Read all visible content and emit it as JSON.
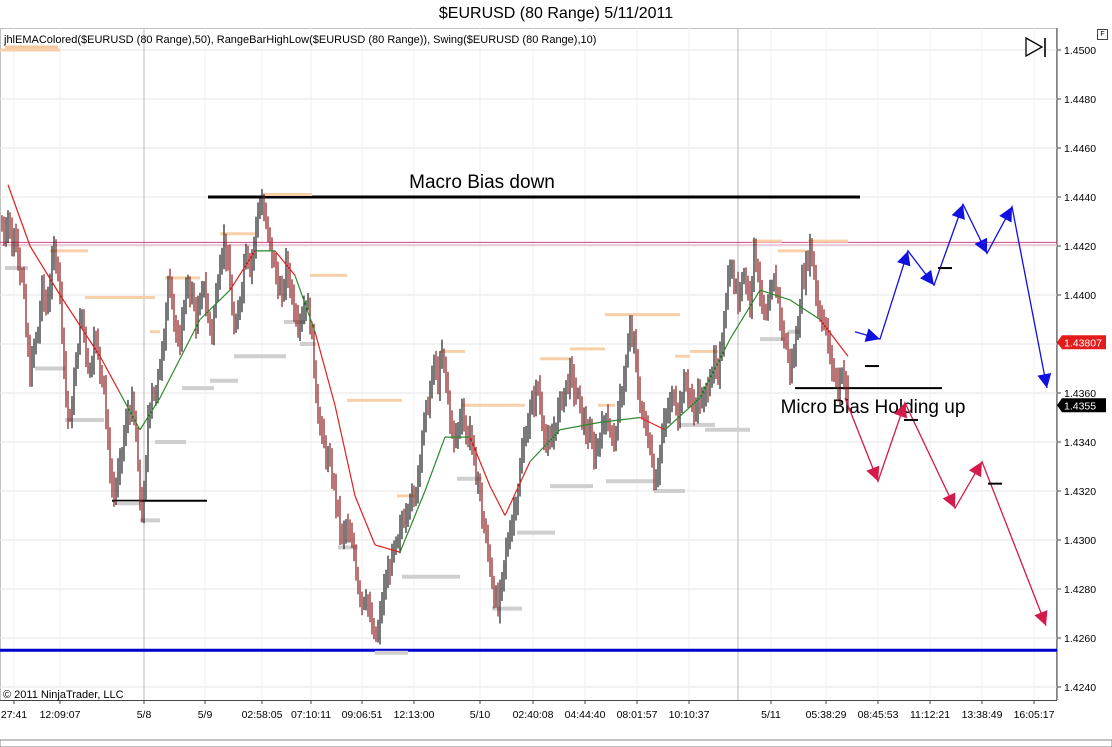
{
  "chart_data": {
    "type": "bar",
    "title": "$EURUSD (80 Range)  5/11/2011",
    "indicators": "jhlEMAColored($EURUSD (80 Range),50), RangeBarHighLow($EURUSD (80 Range)), Swing($EURUSD (80 Range),10)",
    "copyright": "© 2011 NinjaTrader, LLC",
    "ylim": [
      1.4237,
      1.4512
    ],
    "y_ticks": [
      "1.4500",
      "1.4480",
      "1.4460",
      "1.4440",
      "1.4420",
      "1.4400",
      "1.4380",
      "1.4360",
      "1.4340",
      "1.4320",
      "1.4300",
      "1.4280",
      "1.4260",
      "1.4240"
    ],
    "x_ticks": [
      "27:41",
      "12:09:07",
      "5/8",
      "5/9",
      "02:58:05",
      "07:10:11",
      "09:06:51",
      "12:13:00",
      "5/10",
      "02:40:08",
      "04:44:40",
      "08:01:57",
      "10:10:37",
      "5/11",
      "05:38:29",
      "08:45:53",
      "11:12:21",
      "13:38:49",
      "16:05:17"
    ],
    "price_labels": [
      {
        "text": "1.43807",
        "value": 1.43807,
        "color": "#e31b1b"
      },
      {
        "text": "1.4355",
        "value": 1.4355,
        "color": "#000000"
      }
    ],
    "levels": [
      {
        "name": "Macro Bias down",
        "value": 1.444
      },
      {
        "name": "Micro Bias Holding up",
        "value": 1.4362
      },
      {
        "name": "support",
        "value": 1.4255,
        "color": "#0000cc"
      },
      {
        "name": "resistance",
        "value": 1.44215,
        "color": "#cc4488"
      }
    ],
    "annotations": [
      "Macro Bias down",
      "Micro Bias Holding up"
    ],
    "price_path": [
      [
        0,
        1.4437
      ],
      [
        3,
        1.4424
      ],
      [
        8,
        1.4432
      ],
      [
        12,
        1.442
      ],
      [
        16,
        1.4426
      ],
      [
        20,
        1.441
      ],
      [
        23,
        1.4405
      ],
      [
        26,
        1.4385
      ],
      [
        30,
        1.4368
      ],
      [
        34,
        1.4378
      ],
      [
        38,
        1.4385
      ],
      [
        42,
        1.4402
      ],
      [
        46,
        1.4395
      ],
      [
        50,
        1.4405
      ],
      [
        54,
        1.4418
      ],
      [
        58,
        1.4412
      ],
      [
        61,
        1.4395
      ],
      [
        64,
        1.4372
      ],
      [
        67,
        1.4352
      ],
      [
        70,
        1.4348
      ],
      [
        73,
        1.436
      ],
      [
        76,
        1.4372
      ],
      [
        79,
        1.4385
      ],
      [
        82,
        1.4392
      ],
      [
        85,
        1.438
      ],
      [
        88,
        1.4372
      ],
      [
        91,
        1.4368
      ],
      [
        94,
        1.4385
      ],
      [
        97,
        1.4378
      ],
      [
        100,
        1.437
      ],
      [
        104,
        1.4365
      ],
      [
        107,
        1.4342
      ],
      [
        110,
        1.433
      ],
      [
        113,
        1.4318
      ],
      [
        116,
        1.4322
      ],
      [
        120,
        1.433
      ],
      [
        124,
        1.4342
      ],
      [
        128,
        1.4352
      ],
      [
        132,
        1.4355
      ],
      [
        136,
        1.4342
      ],
      [
        139,
        1.432
      ],
      [
        142,
        1.4312
      ],
      [
        145,
        1.432
      ],
      [
        148,
        1.435
      ],
      [
        152,
        1.4362
      ],
      [
        156,
        1.4358
      ],
      [
        160,
        1.4372
      ],
      [
        164,
        1.4385
      ],
      [
        168,
        1.4405
      ],
      [
        172,
        1.4395
      ],
      [
        176,
        1.4385
      ],
      [
        180,
        1.4382
      ],
      [
        184,
        1.4395
      ],
      [
        188,
        1.4405
      ],
      [
        192,
        1.44
      ],
      [
        196,
        1.439
      ],
      [
        200,
        1.4395
      ],
      [
        204,
        1.4405
      ],
      [
        208,
        1.439
      ],
      [
        212,
        1.4385
      ],
      [
        216,
        1.44
      ],
      [
        220,
        1.4415
      ],
      [
        224,
        1.4422
      ],
      [
        228,
        1.4412
      ],
      [
        232,
        1.4395
      ],
      [
        235,
        1.4382
      ],
      [
        238,
        1.4392
      ],
      [
        242,
        1.4405
      ],
      [
        246,
        1.442
      ],
      [
        250,
        1.4412
      ],
      [
        254,
        1.442
      ],
      [
        258,
        1.4435
      ],
      [
        262,
        1.4438
      ],
      [
        266,
        1.4428
      ],
      [
        270,
        1.442
      ],
      [
        274,
        1.4412
      ],
      [
        278,
        1.4405
      ],
      [
        282,
        1.4398
      ],
      [
        286,
        1.4412
      ],
      [
        290,
        1.4405
      ],
      [
        294,
        1.4395
      ],
      [
        298,
        1.439
      ],
      [
        302,
        1.4392
      ],
      [
        306,
        1.4398
      ],
      [
        310,
        1.439
      ],
      [
        314,
        1.4372
      ],
      [
        318,
        1.4352
      ],
      [
        322,
        1.4342
      ],
      [
        326,
        1.4335
      ],
      [
        330,
        1.433
      ],
      [
        334,
        1.4322
      ],
      [
        338,
        1.431
      ],
      [
        342,
        1.43
      ],
      [
        346,
        1.4305
      ],
      [
        350,
        1.43
      ],
      [
        354,
        1.4295
      ],
      [
        358,
        1.4282
      ],
      [
        362,
        1.4275
      ],
      [
        366,
        1.4278
      ],
      [
        370,
        1.4268
      ],
      [
        374,
        1.426
      ],
      [
        378,
        1.4262
      ],
      [
        382,
        1.4275
      ],
      [
        386,
        1.4283
      ],
      [
        390,
        1.429
      ],
      [
        394,
        1.4295
      ],
      [
        398,
        1.4298
      ],
      [
        402,
        1.4308
      ],
      [
        406,
        1.4312
      ],
      [
        410,
        1.4318
      ],
      [
        414,
        1.4315
      ],
      [
        418,
        1.4328
      ],
      [
        422,
        1.4342
      ],
      [
        426,
        1.4352
      ],
      [
        430,
        1.436
      ],
      [
        434,
        1.4372
      ],
      [
        438,
        1.4365
      ],
      [
        442,
        1.4375
      ],
      [
        446,
        1.4365
      ],
      [
        450,
        1.435
      ],
      [
        454,
        1.434
      ],
      [
        458,
        1.4345
      ],
      [
        462,
        1.4355
      ],
      [
        466,
        1.4342
      ],
      [
        470,
        1.4345
      ],
      [
        474,
        1.433
      ],
      [
        478,
        1.4325
      ],
      [
        482,
        1.431
      ],
      [
        486,
        1.43
      ],
      [
        490,
        1.429
      ],
      [
        494,
        1.4278
      ],
      [
        498,
        1.4272
      ],
      [
        502,
        1.4282
      ],
      [
        506,
        1.4295
      ],
      [
        510,
        1.4305
      ],
      [
        514,
        1.4312
      ],
      [
        518,
        1.4322
      ],
      [
        522,
        1.4335
      ],
      [
        526,
        1.4345
      ],
      [
        530,
        1.4352
      ],
      [
        534,
        1.4358
      ],
      [
        538,
        1.4362
      ],
      [
        542,
        1.435
      ],
      [
        546,
        1.434
      ],
      [
        550,
        1.4338
      ],
      [
        554,
        1.4345
      ],
      [
        558,
        1.4352
      ],
      [
        562,
        1.4358
      ],
      [
        566,
        1.4362
      ],
      [
        570,
        1.4368
      ],
      [
        574,
        1.4362
      ],
      [
        578,
        1.4358
      ],
      [
        582,
        1.435
      ],
      [
        586,
        1.4345
      ],
      [
        590,
        1.4342
      ],
      [
        594,
        1.4335
      ],
      [
        598,
        1.434
      ],
      [
        602,
        1.4345
      ],
      [
        606,
        1.4352
      ],
      [
        610,
        1.4345
      ],
      [
        614,
        1.434
      ],
      [
        618,
        1.435
      ],
      [
        622,
        1.4362
      ],
      [
        626,
        1.4372
      ],
      [
        630,
        1.4385
      ],
      [
        634,
        1.438
      ],
      [
        638,
        1.4362
      ],
      [
        642,
        1.4352
      ],
      [
        646,
        1.4345
      ],
      [
        650,
        1.434
      ],
      [
        654,
        1.4325
      ],
      [
        658,
        1.433
      ],
      [
        662,
        1.4342
      ],
      [
        666,
        1.435
      ],
      [
        670,
        1.4355
      ],
      [
        674,
        1.436
      ],
      [
        678,
        1.4352
      ],
      [
        682,
        1.436
      ],
      [
        686,
        1.4365
      ],
      [
        690,
        1.4358
      ],
      [
        694,
        1.4352
      ],
      [
        698,
        1.436
      ],
      [
        702,
        1.4355
      ],
      [
        706,
        1.436
      ],
      [
        710,
        1.4368
      ],
      [
        714,
        1.4372
      ],
      [
        718,
        1.4365
      ],
      [
        722,
        1.4382
      ],
      [
        726,
        1.44
      ],
      [
        730,
        1.4412
      ],
      [
        734,
        1.4405
      ],
      [
        738,
        1.4398
      ],
      [
        742,
        1.441
      ],
      [
        746,
        1.4405
      ],
      [
        750,
        1.4398
      ],
      [
        754,
        1.4418
      ],
      [
        758,
        1.441
      ],
      [
        762,
        1.4395
      ],
      [
        766,
        1.439
      ],
      [
        770,
        1.4398
      ],
      [
        774,
        1.4405
      ],
      [
        778,
        1.44
      ],
      [
        782,
        1.4385
      ],
      [
        786,
        1.438
      ],
      [
        790,
        1.437
      ],
      [
        794,
        1.4375
      ],
      [
        798,
        1.439
      ],
      [
        802,
        1.4405
      ],
      [
        806,
        1.4412
      ],
      [
        810,
        1.442
      ],
      [
        814,
        1.441
      ],
      [
        818,
        1.4395
      ],
      [
        822,
        1.4392
      ],
      [
        826,
        1.4385
      ],
      [
        830,
        1.4375
      ],
      [
        834,
        1.4368
      ],
      [
        838,
        1.4362
      ],
      [
        842,
        1.437
      ],
      [
        845,
        1.4365
      ],
      [
        848,
        1.4355
      ]
    ],
    "ema_path": [
      [
        8,
        1.4445
      ],
      [
        30,
        1.442
      ],
      [
        60,
        1.44
      ],
      [
        100,
        1.4375
      ],
      [
        120,
        1.436
      ],
      [
        140,
        1.4345
      ],
      [
        160,
        1.4358
      ],
      [
        200,
        1.439
      ],
      [
        230,
        1.4402
      ],
      [
        255,
        1.4418
      ],
      [
        275,
        1.4418
      ],
      [
        295,
        1.4408
      ],
      [
        315,
        1.4385
      ],
      [
        335,
        1.4355
      ],
      [
        355,
        1.4318
      ],
      [
        375,
        1.4298
      ],
      [
        400,
        1.4295
      ],
      [
        425,
        1.432
      ],
      [
        445,
        1.4342
      ],
      [
        470,
        1.4342
      ],
      [
        490,
        1.4322
      ],
      [
        505,
        1.431
      ],
      [
        530,
        1.4332
      ],
      [
        560,
        1.4345
      ],
      [
        600,
        1.4348
      ],
      [
        640,
        1.435
      ],
      [
        665,
        1.4345
      ],
      [
        700,
        1.4358
      ],
      [
        730,
        1.4382
      ],
      [
        760,
        1.4402
      ],
      [
        790,
        1.4398
      ],
      [
        820,
        1.439
      ],
      [
        848,
        1.4375
      ]
    ],
    "swing_highs": [
      [
        0,
        60,
        1.45
      ],
      [
        50,
        88,
        1.4418
      ],
      [
        85,
        155,
        1.4399
      ],
      [
        150,
        160,
        1.4385
      ],
      [
        165,
        200,
        1.4407
      ],
      [
        220,
        255,
        1.4425
      ],
      [
        265,
        312,
        1.4441
      ],
      [
        310,
        347,
        1.4408
      ],
      [
        347,
        402,
        1.4357
      ],
      [
        397,
        415,
        1.4318
      ],
      [
        440,
        465,
        1.4377
      ],
      [
        462,
        525,
        1.4355
      ],
      [
        540,
        570,
        1.4374
      ],
      [
        570,
        605,
        1.4378
      ],
      [
        598,
        615,
        1.4355
      ],
      [
        605,
        680,
        1.4392
      ],
      [
        675,
        690,
        1.4375
      ],
      [
        690,
        718,
        1.4377
      ],
      [
        752,
        782,
        1.4422
      ],
      [
        778,
        805,
        1.4418
      ],
      [
        808,
        848,
        1.4422
      ]
    ],
    "swing_lows": [
      [
        5,
        28,
        1.4411
      ],
      [
        35,
        65,
        1.437
      ],
      [
        65,
        104,
        1.4349
      ],
      [
        115,
        140,
        1.4315
      ],
      [
        140,
        160,
        1.4308
      ],
      [
        155,
        186,
        1.434
      ],
      [
        182,
        214,
        1.4362
      ],
      [
        210,
        238,
        1.4365
      ],
      [
        234,
        286,
        1.4375
      ],
      [
        284,
        306,
        1.4389
      ],
      [
        300,
        316,
        1.438
      ],
      [
        338,
        358,
        1.4297
      ],
      [
        402,
        460,
        1.4285
      ],
      [
        457,
        482,
        1.4325
      ],
      [
        492,
        522,
        1.4272
      ],
      [
        517,
        555,
        1.4303
      ],
      [
        550,
        593,
        1.4322
      ],
      [
        606,
        654,
        1.4324
      ],
      [
        654,
        685,
        1.432
      ],
      [
        680,
        715,
        1.4347
      ],
      [
        705,
        750,
        1.4345
      ],
      [
        760,
        785,
        1.4382
      ],
      [
        788,
        800,
        1.4385
      ],
      [
        375,
        408,
        1.4254
      ]
    ],
    "bullish_path": [
      [
        855,
        1.4385
      ],
      [
        880,
        1.4382
      ],
      [
        908,
        1.4418
      ],
      [
        934,
        1.4404
      ],
      [
        963,
        1.4437
      ],
      [
        987,
        1.4417
      ],
      [
        1012,
        1.4436
      ],
      [
        1047,
        1.4362
      ]
    ],
    "bearish_path": [
      [
        845,
        1.4358
      ],
      [
        878,
        1.4324
      ],
      [
        905,
        1.4356
      ],
      [
        955,
        1.4313
      ],
      [
        982,
        1.4332
      ],
      [
        1046,
        1.4265
      ]
    ],
    "dashes": [
      [
        865,
        1.4371
      ],
      [
        938,
        1.4411
      ],
      [
        904,
        1.4349
      ],
      [
        988,
        1.4323
      ]
    ],
    "vline_x": [
      144,
      738
    ]
  }
}
